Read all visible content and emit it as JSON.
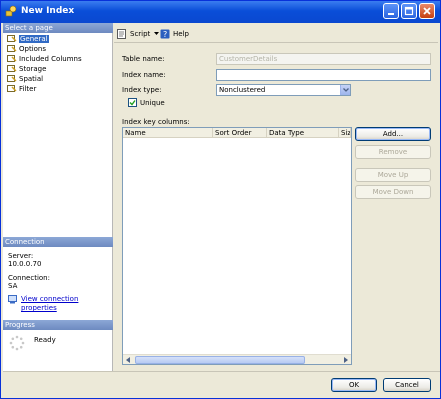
{
  "window": {
    "title": "New Index"
  },
  "left_pane": {
    "select_page_header": "Select a page",
    "pages": [
      "General",
      "Options",
      "Included Columns",
      "Storage",
      "Spatial",
      "Filter"
    ],
    "selected_page": "General",
    "connection_header": "Connection",
    "server_label": "Server:",
    "server_value": "10.0.0.70",
    "connection_label": "Connection:",
    "connection_value": "SA",
    "view_connection_link": "View connection properties",
    "progress_header": "Progress",
    "progress_status": "Ready"
  },
  "toolbar": {
    "script_label": "Script",
    "help_label": "Help"
  },
  "form": {
    "table_name_label": "Table name:",
    "table_name_value": "CustomerDetails",
    "index_name_label": "Index name:",
    "index_name_value": "",
    "index_type_label": "Index type:",
    "index_type_value": "Nonclustered",
    "unique_label": "Unique",
    "unique_checked": true,
    "key_columns_label": "Index key columns:"
  },
  "grid": {
    "columns": [
      "Name",
      "Sort Order",
      "Data Type",
      "Size"
    ]
  },
  "buttons": {
    "add": "Add...",
    "remove": "Remove",
    "move_up": "Move Up",
    "move_down": "Move Down",
    "ok": "OK",
    "cancel": "Cancel"
  },
  "colors": {
    "title_bar": "#0a4ed8",
    "selection": "#316ac5",
    "section_header": "#7590c4"
  }
}
